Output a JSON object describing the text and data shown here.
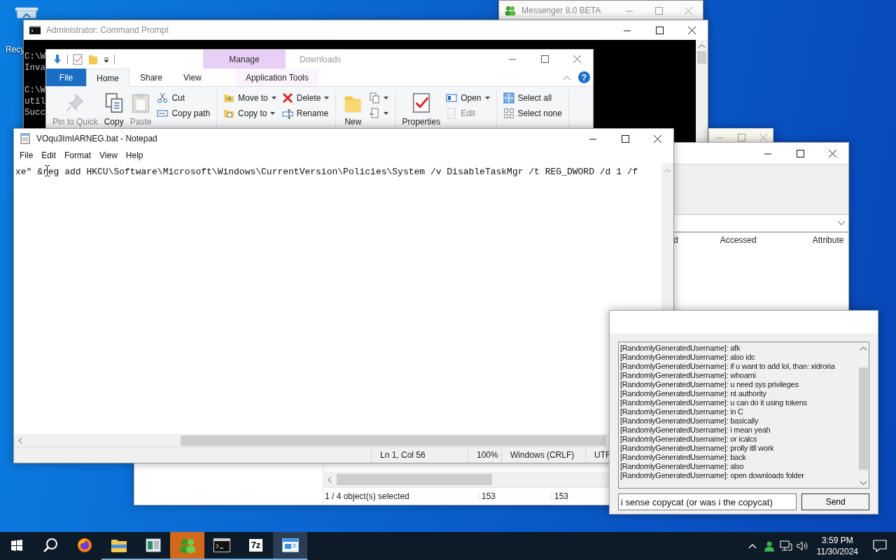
{
  "desktop_icons": [
    {
      "label": "Recy"
    }
  ],
  "messenger_window": {
    "title": "Messenger 8.0 BETA"
  },
  "command_prompt": {
    "title": "Administrator: Command Prompt",
    "blocks": [
      [
        "C:\\W",
        "Inva"
      ],
      [
        "C:\\W",
        "util",
        "Succ"
      ]
    ]
  },
  "explorer_ribbon": {
    "title": "Downloads",
    "context_header": "Manage",
    "help": "?",
    "tabs": [
      {
        "label": "File",
        "kind": "menu",
        "selected": false
      },
      {
        "label": "Home",
        "kind": "tab",
        "selected": true
      },
      {
        "label": "Share",
        "kind": "tab",
        "selected": false
      },
      {
        "label": "View",
        "kind": "tab",
        "selected": false
      },
      {
        "label": "Application Tools",
        "kind": "context",
        "selected": false
      }
    ],
    "groups": [
      {
        "columns": [
          {
            "kind": "large",
            "label": "Pin to Quick",
            "disabled": true
          },
          {
            "kind": "large",
            "label": "Copy",
            "disabled": false
          },
          {
            "kind": "large",
            "label": "Paste",
            "disabled": true
          },
          {
            "kind": "stack",
            "items": [
              {
                "label": "Cut",
                "disabled": false,
                "dropdown": false
              },
              {
                "label": "Copy path",
                "disabled": false,
                "dropdown": false
              }
            ]
          }
        ]
      },
      {
        "columns": [
          {
            "kind": "stack",
            "items": [
              {
                "label": "Move to",
                "disabled": false,
                "dropdown": true
              },
              {
                "label": "Copy to",
                "disabled": false,
                "dropdown": true
              }
            ]
          },
          {
            "kind": "stack",
            "items": [
              {
                "label": "Delete",
                "disabled": false,
                "dropdown": true
              },
              {
                "label": "Rename",
                "disabled": false,
                "dropdown": false
              }
            ]
          }
        ]
      },
      {
        "columns": [
          {
            "kind": "large",
            "label": "New",
            "disabled": false
          },
          {
            "kind": "stack",
            "items": [
              {
                "dropdown": true,
                "disabled": false
              },
              {
                "dropdown": true,
                "disabled": false
              }
            ]
          }
        ]
      },
      {
        "columns": [
          {
            "kind": "large",
            "label": "Properties",
            "disabled": false
          },
          {
            "kind": "stack",
            "items": [
              {
                "label": "Open",
                "disabled": false,
                "dropdown": true
              },
              {
                "label": "Edit",
                "disabled": true,
                "dropdown": false
              }
            ]
          }
        ]
      },
      {
        "columns": [
          {
            "kind": "stack",
            "items": [
              {
                "label": "Select all",
                "disabled": false,
                "dropdown": false
              },
              {
                "label": "Select none",
                "disabled": false,
                "dropdown": false
              }
            ]
          }
        ]
      }
    ]
  },
  "details_window": {
    "columns": [
      "d",
      "Accessed",
      "Attribute"
    ],
    "status": "1 / 4 object(s) selected",
    "status_cells": [
      "153",
      "153"
    ]
  },
  "notepad": {
    "title": "VOqu3ImIARNEG.bat - Notepad",
    "menu": [
      "File",
      "Edit",
      "Format",
      "View",
      "Help"
    ],
    "text": "xe\" &reg add HKCU\\Software\\Microsoft\\Windows\\CurrentVersion\\Policies\\System /v DisableTaskMgr /t REG_DWORD /d 1 /f",
    "status": [
      "Ln 1, Col 56",
      "100%",
      "Windows (CRLF)",
      "UTF"
    ]
  },
  "chat": {
    "messages": [
      "[RandomlyGeneratedUsername]: afk",
      "[RandomlyGeneratedUsername]: also idc",
      "[RandomlyGeneratedUsername]: if u want to add lol, than: xidroria",
      "[RandomlyGeneratedUsername]: whoami",
      "[RandomlyGeneratedUsername]: u need sys privileges",
      "[RandomlyGeneratedUsername]: nt authority",
      "[RandomlyGeneratedUsername]: u can do it using tokens",
      "[RandomlyGeneratedUsername]: in C",
      "[RandomlyGeneratedUsername]: basically",
      "[RandomlyGeneratedUsername]: i mean yeah",
      "[RandomlyGeneratedUsername]: or icalcs",
      "[RandomlyGeneratedUsername]: prolly itll work",
      "[RandomlyGeneratedUsername]: back",
      "[RandomlyGeneratedUsername]: also",
      "[RandomlyGeneratedUsername]: open downloads folder"
    ],
    "input": "i sense copycat (or was i the copycat)",
    "send": "Send"
  },
  "taskbar": {
    "apps": [
      {
        "kind": "firefox",
        "running": false,
        "flashing": false,
        "selected": false
      },
      {
        "kind": "explorer",
        "running": true,
        "flashing": false,
        "selected": false
      },
      {
        "kind": "reader",
        "running": true,
        "flashing": false,
        "selected": false
      },
      {
        "kind": "messenger",
        "running": true,
        "flashing": true,
        "selected": false
      },
      {
        "kind": "console",
        "running": true,
        "flashing": false,
        "selected": false
      },
      {
        "kind": "archiver",
        "label": "7z",
        "running": true,
        "flashing": false,
        "selected": false
      },
      {
        "kind": "notepad",
        "running": true,
        "flashing": false,
        "selected": true
      }
    ],
    "time": "3:59 PM",
    "date": "11/30/2024"
  }
}
